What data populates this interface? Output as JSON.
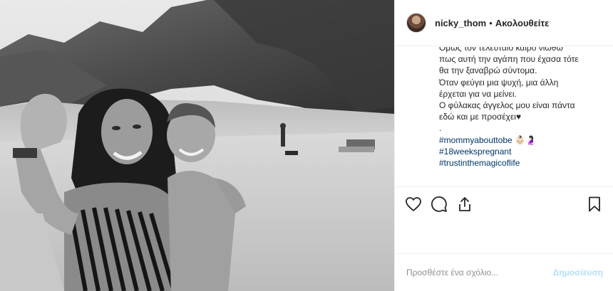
{
  "header": {
    "username": "nicky_thom",
    "separator": "•",
    "follow_label": "Ακολουθείτε"
  },
  "caption": {
    "lines": [
      "Όμως τον τελευταίο καιρό νιώθω",
      "πως αυτή την αγάπη που έχασα τότε",
      "θα την ξαναβρώ σύντομα.",
      "Όταν φεύγει μια ψυχή, μια άλλη",
      "έρχεται για να μείνει.",
      "Ο φύλακας άγγελος μου είναι πάντα",
      "εδώ και με προσέχει♥",
      "."
    ],
    "hashtags": [
      "#mommyabouttobe 👶🏻🤰🏻",
      "#18weekspregnant",
      "#trustinthemagicoflife"
    ]
  },
  "actions": {
    "icons": [
      "heart-icon",
      "comment-icon",
      "share-icon",
      "bookmark-icon"
    ]
  },
  "comment_bar": {
    "placeholder": "Προσθέστε ένα σχόλιο...",
    "post_label": "Δημοσίευση"
  },
  "colors": {
    "border": "#efefef",
    "text": "#262626",
    "hashtag": "#003569",
    "muted": "#8e8e8e",
    "post_disabled": "#b2dffc"
  }
}
